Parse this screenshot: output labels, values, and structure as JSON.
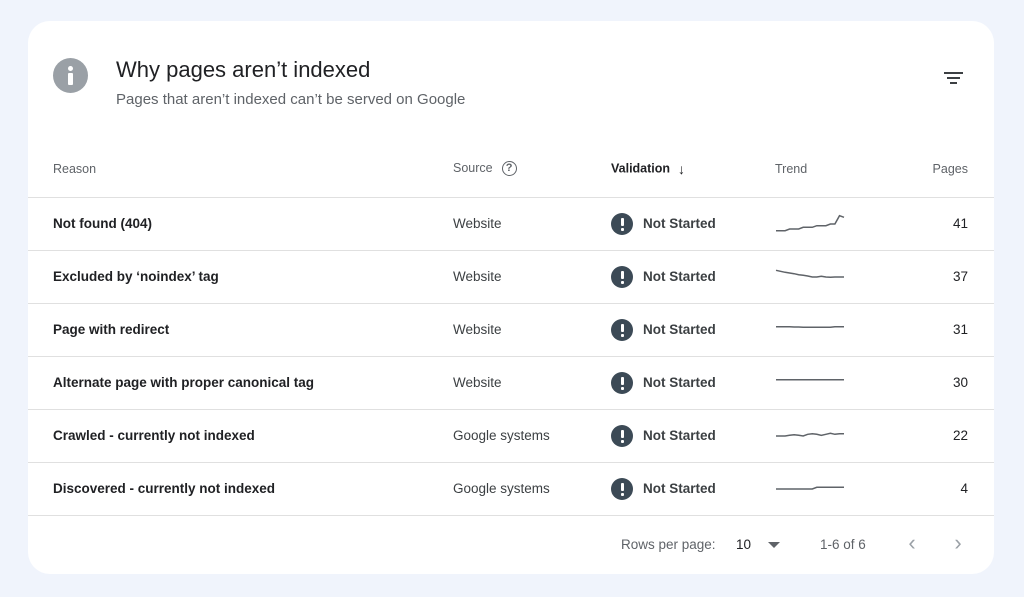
{
  "header": {
    "title": "Why pages aren’t indexed",
    "subtitle": "Pages that aren’t indexed can’t be served on Google",
    "info_icon": "info-icon",
    "filter_icon": "filter-icon"
  },
  "columns": {
    "reason": "Reason",
    "source": "Source",
    "validation": "Validation",
    "trend": "Trend",
    "pages": "Pages",
    "help_glyph": "?",
    "sort_glyph": "↓"
  },
  "rows": [
    {
      "reason": "Not found (404)",
      "source": "Website",
      "validation": "Not Started",
      "pages": "41",
      "trend": [
        5,
        5,
        5,
        4.5,
        4.5,
        4.5,
        4,
        4,
        4,
        3.5,
        3.5,
        3.5,
        3,
        3,
        0.5,
        1
      ]
    },
    {
      "reason": "Excluded by ‘noindex’ tag",
      "source": "Website",
      "validation": "Not Started",
      "pages": "37",
      "trend": [
        1,
        1.3,
        1.6,
        1.8,
        2,
        2.3,
        2.5,
        2.7,
        3,
        3,
        2.8,
        3,
        3.1,
        3,
        3,
        3
      ]
    },
    {
      "reason": "Page with redirect",
      "source": "Website",
      "validation": "Not Started",
      "pages": "31",
      "trend": [
        2,
        2,
        2,
        2,
        2.1,
        2.1,
        2.2,
        2.2,
        2.2,
        2.2,
        2.2,
        2.2,
        2.2,
        2,
        2,
        2
      ]
    },
    {
      "reason": "Alternate page with proper canonical tag",
      "source": "Website",
      "validation": "Not Started",
      "pages": "30",
      "trend": [
        2,
        2,
        2,
        2,
        2,
        2,
        2,
        2,
        2,
        2,
        2,
        2,
        2,
        2,
        2,
        2
      ]
    },
    {
      "reason": "Crawled - currently not indexed",
      "source": "Google systems",
      "validation": "Not Started",
      "pages": "22",
      "trend": [
        3,
        3,
        3,
        2.8,
        2.6,
        2.8,
        3,
        2.5,
        2.3,
        2.5,
        2.8,
        2.5,
        2.2,
        2.5,
        2.3,
        2.3
      ]
    },
    {
      "reason": "Discovered - currently not indexed",
      "source": "Google systems",
      "validation": "Not Started",
      "pages": "4",
      "trend": [
        3,
        3,
        3,
        3,
        3,
        3,
        3,
        3,
        3,
        2.5,
        2.5,
        2.5,
        2.5,
        2.5,
        2.5,
        2.5
      ]
    }
  ],
  "footer": {
    "rows_per_page_label": "Rows per page:",
    "rows_per_page_value": "10",
    "range": "1-6 of 6",
    "prev_glyph": "‹",
    "next_glyph": "›"
  },
  "colors": {
    "background": "#f0f4fc",
    "status_icon": "#3c4a56",
    "sparkline": "#5f6368"
  }
}
